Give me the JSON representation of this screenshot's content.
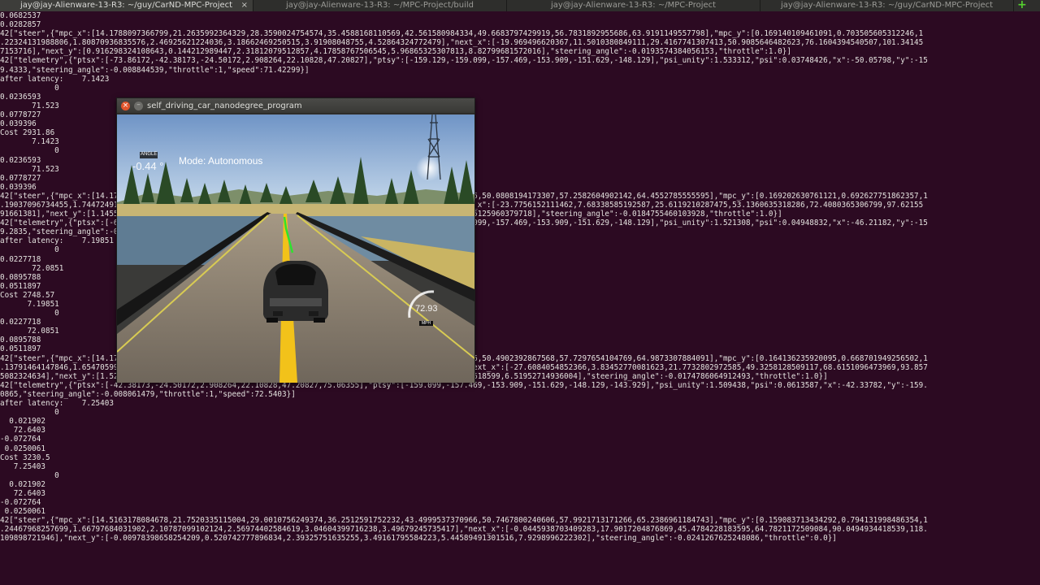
{
  "tabs": [
    {
      "label": "jay@jay-Alienware-13-R3: ~/guy/CarND-MPC-Project",
      "active": true,
      "close": "×"
    },
    {
      "label": "jay@jay-Alienware-13-R3: ~/MPC-Project/build"
    },
    {
      "label": "jay@jay-Alienware-13-R3: ~/MPC-Project"
    },
    {
      "label": "jay@jay-Alienware-13-R3: ~/guy/CarND-MPC-Project"
    }
  ],
  "new_tab_icon": "plus-icon",
  "terminal": {
    "lines": [
      "0.0682537",
      "0.0282857",
      "42[\"steer\",{\"mpc_x\":[14.1788097366799,21.2635992364329,28.3590024754574,35.4588168110569,42.561580984334,49.6683797429919,56.7831892955686,63.9191149557798],\"mpc_y\":[0.169140109461091,0.703505605312246,1",
      ".22324131988806,1.80870936835576,2.46925621224036,3.18662469250515,3.91908048755,4.52864324772479],\"next_x\":[-19.969496620367,11.5010380849111,29.4167741307413,50.9085646482623,76.1604394540507,101.34145",
      "7153716],\"next_y\":[0.916298324108643,0.144212989447,2.31812079512857,4.17858767506545,5.96865325307813,8.82799681572016],\"steering_angle\":-0.0193574384056153,\"throttle\":1.0}]",
      "42[\"telemetry\",{\"ptsx\":[-73.86172,-42.38173,-24.50172,2.908264,22.10828,47.20827],\"ptsy\":[-159.129,-159.099,-157.469,-153.909,-151.629,-148.129],\"psi_unity\":1.533312,\"psi\":0.03748426,\"x\":-50.05798,\"y\":-15",
      "9.4333,\"steering_angle\":-0.008844539,\"throttle\":1,\"speed\":71.42299}]",
      "after latency:    7.1423",
      "            0",
      "0.0236593",
      "       71.523",
      "0.0778727",
      "0.039396",
      "Cost 2931.86",
      "       7.1423",
      "            0",
      "0.0236593",
      "       71.523",
      "0.0778727",
      "0.039396",
      "42[\"steer\",{\"mpc_x\":[14.1788097366799,21.2635992364329,28.3590024754574,35.4588168110569,42.5642055213926,50.0808194173307,57.2582604902142,64.4552785555595],\"mpc_y\":[0.169202630761121,0.692627751862357,1",
      ".19037096734455,1.74472491236715,2.40135467230954,3.12853425081509,3.89274637506101,4.63541521509],\"next_x\":[-23.7756152111462,7.68338585192587,25.6119210287475,53.1360635318286,72.4080365306799,97.62155",
      "91661381],\"next_y\":[1.14556302180713,0.0782813561903,1.89025614218,3.85101432416,5.84255735242688653,7.65125960379718],\"steering_angle\":-0.0184755460103928,\"throttle\":1.0}]",
      "42[\"telemetry\",{\"ptsx\":[-61.88173,-42.38173,-24.50172,2.908264,22.10828,47.20827],\"ptsy\":[-159.129,-159.099,-157.469,-153.909,-151.629,-148.129],\"psi_unity\":1.521308,\"psi\":0.04948832,\"x\":-46.21182,\"y\":-15",
      "9.2835,\"steering_angle\":-0.008061479,\"throttle\":1,\"speed\":72.0851}]",
      "after latency:    7.19851",
      "            0",
      "0.0227718",
      "       72.0851",
      "0.0895788",
      "0.0511897",
      "Cost 2748.57",
      "      7.19851",
      "            0",
      "0.0227718",
      "      72.0851",
      "0.0895788",
      "0.0511897",
      "42[\"steer\",{\"mpc_x\":[14.1788097366799,21.2635992364329,28.3590024754574,35.4588168110569,42.5690901853376,50.4902392867568,57.7297654104769,64.9873307884091],\"mpc_y\":[0.164136235920095,0.668701949256502,1",
      ".13791464147846,1.65470599192301,2.22602951230977,2.84008397062231,3.45399151076004,3.95748008550954],\"next_x\":[-27.6084054852366,3.83452770081623,21.7732802972585,49.3258128509117,68.6151096473969,93.857",
      "5082324634],\"next_y\":[1.52209947860143,-0.00519324302054799,0.738320632931907,2.93804169709882,4.2654615618599,6.51952714936004],\"steering_angle\":-0.0174786064912493,\"throttle\":1.0}]",
      "42[\"telemetry\",{\"ptsx\":[-42.38173,-24.50172,2.908264,22.10828,47.20827,75.06355],\"ptsy\":[-159.099,-157.469,-153.909,-151.629,-148.129,-143.929],\"psi_unity\":1.509438,\"psi\":0.0613587,\"x\":-42.33782,\"y\":-159.",
      "0865,\"steering_angle\":-0.008061479,\"throttle\":1,\"speed\":72.5403}]",
      "after latency:    7.25403",
      "            0",
      "  0.021902",
      "   72.6403",
      "-0.072764",
      " 0.0250061",
      "Cost 3230.5",
      "   7.25403",
      "            0",
      "  0.021902",
      "   72.6403",
      "-0.072764",
      " 0.0250061",
      "42[\"steer\",{\"mpc_x\":[14.5163178084678,21.7520335115004,29.0010756249374,36.2512591752232,43.4999537370966,50.7467800240606,57.9921713171266,65.2386961184743],\"mpc_y\":[0.159083713434292,0.794131998486354,1",
      ".24467968257699,1.66797684031902,2.10787099102124,2.56974402584619,3.04604399716238,3.49679245735417],\"next_x\":[-0.0445938703409283,17.9017204876869,45.4784228183595,64.7821172509084,90.0494934418539,118.",
      "109898721946],\"next_y\":[-0.00978398658254209,0.520742777896834,2.39325751635255,3.49161795584223,5.44589491301516,7.9298996222302],\"steering_angle\":-0.0241267625248086,\"throttle\":0.0}]"
    ]
  },
  "simulator": {
    "title": "self_driving_car_nanodegree_program",
    "close_label": "×",
    "minimize_label": "–",
    "angle_label": "ANGLE",
    "angle_value": "-0.44 °",
    "mode_text": "Mode: Autonomous",
    "speed_value": "72.93",
    "speed_unit": "MPH",
    "colors": {
      "sky_top": "#6f94c6",
      "sky_bottom": "#cfe0ef",
      "road": "#8f8273",
      "center_line": "#f2c21a",
      "trajectory": "#2ee32e"
    }
  }
}
